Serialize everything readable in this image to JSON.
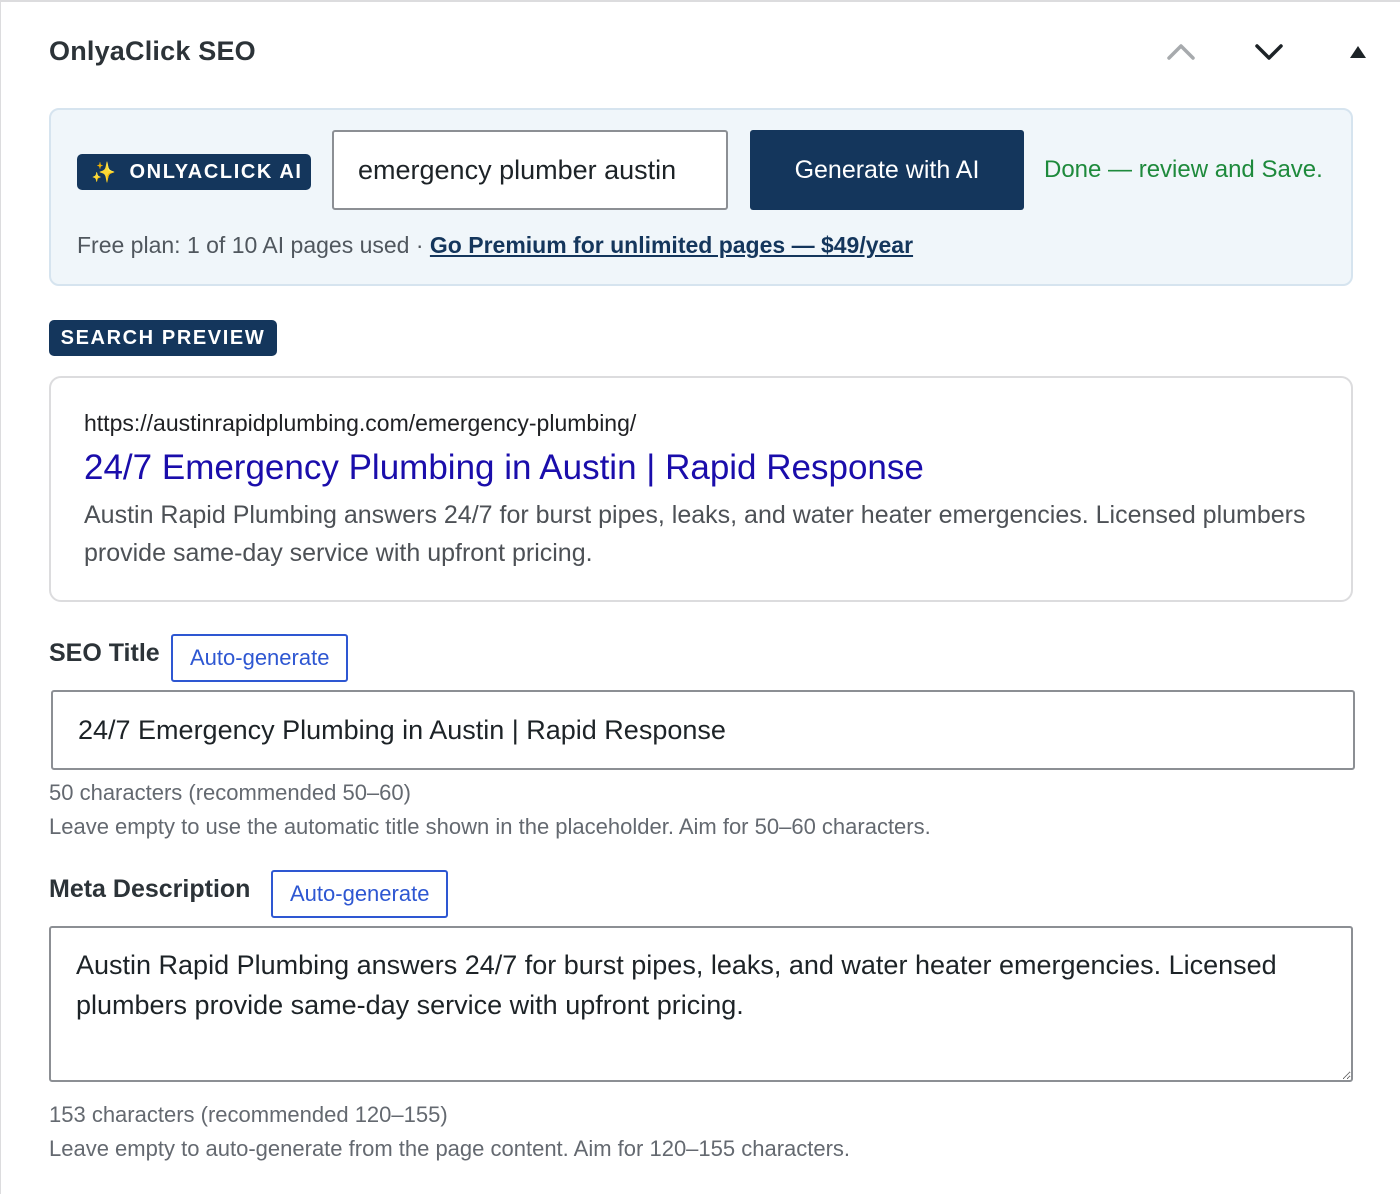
{
  "panel": {
    "title": "OnlyaClick SEO",
    "controls": {
      "move_up_icon": "chevron-up-icon",
      "move_down_icon": "chevron-down-icon",
      "toggle_icon": "triangle-up-icon"
    }
  },
  "ai": {
    "badge_icon": "✨",
    "badge_label": "ONLYACLICK AI",
    "keyword_value": "emergency plumber austin",
    "generate_label": "Generate with AI",
    "status": "Done — review and Save.",
    "plan_text": "Free plan: 1 of 10 AI pages used · ",
    "premium_link": "Go Premium for unlimited pages — $49/year"
  },
  "preview": {
    "tag": "SEARCH PREVIEW",
    "url": "https://austinrapidplumbing.com/emergency-plumbing/",
    "title": "24/7 Emergency Plumbing in Austin | Rapid Response",
    "description": "Austin Rapid Plumbing answers 24/7 for burst pipes, leaks, and water heater emergencies. Licensed plumbers provide same-day service with upfront pricing."
  },
  "seo_title": {
    "label": "SEO Title",
    "auto_label": "Auto-generate",
    "value": "24/7 Emergency Plumbing in Austin | Rapid Response",
    "count": "50 characters (recommended 50–60)",
    "help": "Leave empty to use the automatic title shown in the placeholder. Aim for 50–60 characters."
  },
  "meta_description": {
    "label": "Meta Description",
    "auto_label": "Auto-generate",
    "value": "Austin Rapid Plumbing answers 24/7 for burst pipes, leaks, and water heater emergencies. Licensed plumbers provide same-day service with upfront pricing.",
    "count": "153 characters (recommended 120–155)",
    "help": "Leave empty to auto-generate from the page content. Aim for 120–155 characters."
  },
  "colors": {
    "navy": "#14365c",
    "success": "#1e8a3c",
    "link_blue": "#2e57d2",
    "serp_title": "#1a0dab"
  }
}
